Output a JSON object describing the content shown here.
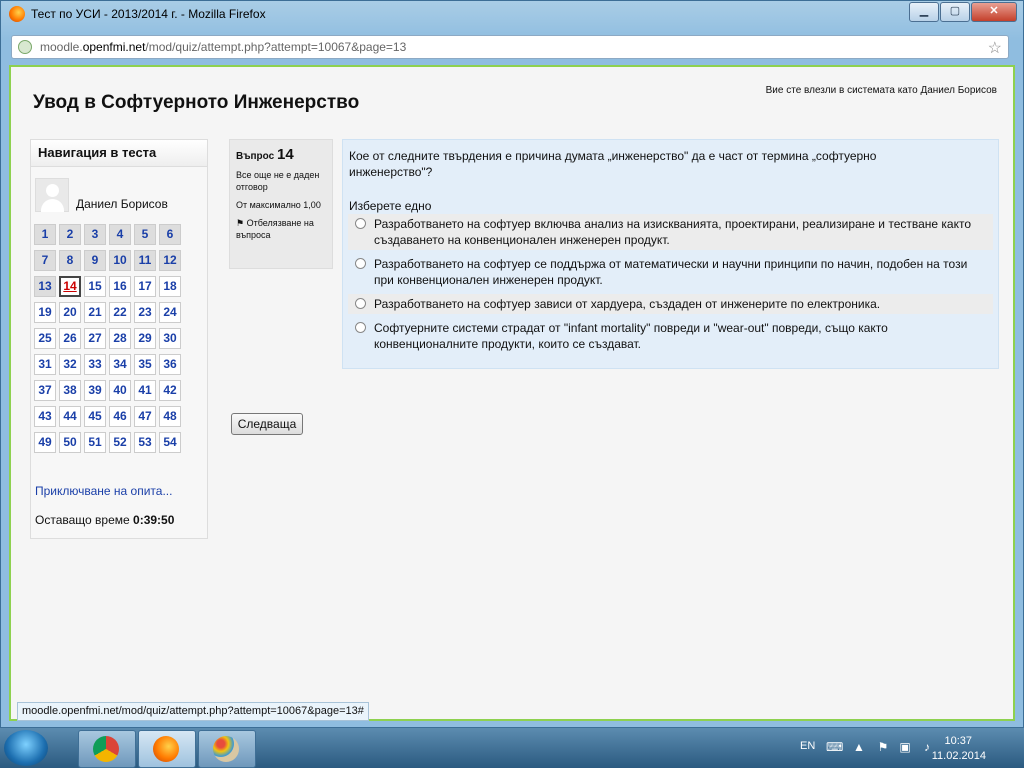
{
  "window": {
    "title": "Тест по УСИ - 2013/2014 г. - Mozilla Firefox"
  },
  "url": {
    "domain_prefix": "moodle.",
    "domain": "openfmi.net",
    "path": "/mod/quiz/attempt.php?attempt=10067&page=13"
  },
  "page": {
    "course_title": "Увод в Софтуерното Инженерство",
    "login_info": "Вие сте влезли в системата като Даниел Борисов"
  },
  "nav": {
    "heading": "Навигация в теста",
    "user_name": "Даниел Борисов",
    "questions": [
      "1",
      "2",
      "3",
      "4",
      "5",
      "6",
      "7",
      "8",
      "9",
      "10",
      "11",
      "12",
      "13",
      "14",
      "15",
      "16",
      "17",
      "18",
      "19",
      "20",
      "21",
      "22",
      "23",
      "24",
      "25",
      "26",
      "27",
      "28",
      "29",
      "30",
      "31",
      "32",
      "33",
      "34",
      "35",
      "36",
      "37",
      "38",
      "39",
      "40",
      "41",
      "42",
      "43",
      "44",
      "45",
      "46",
      "47",
      "48",
      "49",
      "50",
      "51",
      "52",
      "53",
      "54"
    ],
    "current": "14",
    "finish_link": "Приключване на опита...",
    "timer_label": "Оставащо време",
    "timer_value": "0:39:50"
  },
  "question": {
    "label": "Въпрос",
    "number": "14",
    "state": "Все още не е даден отговор",
    "mark": "От максимално 1,00",
    "flag": "Отбелязване на въпроса",
    "text": "Кое от следните твърдения е причина думата „инженерство\" да е част от термина „софтуерно инженерство\"?",
    "prompt": "Изберете едно",
    "answers": [
      "Разработването на софтуер включва анализ на изискванията, проектирани, реализиране и тестване както създаването на конвенционален инженерен продукт.",
      "Разработването на софтуер се поддържа от математически и научни принципи по начин, подобен на този при конвенционален инженерен продукт.",
      "Разработването на софтуер зависи от хардуера, създаден от инженерите по електроника.",
      "Софтуерните системи страдат от \"infant mortality\" повреди и \"wear-out\" повреди, също както конвенционалните продукти, които се създават."
    ],
    "next_button": "Следваща"
  },
  "status_url": "moodle.openfmi.net/mod/quiz/attempt.php?attempt=10067&page=13#",
  "taskbar": {
    "lang": "EN",
    "time": "10:37",
    "date": "11.02.2014"
  }
}
